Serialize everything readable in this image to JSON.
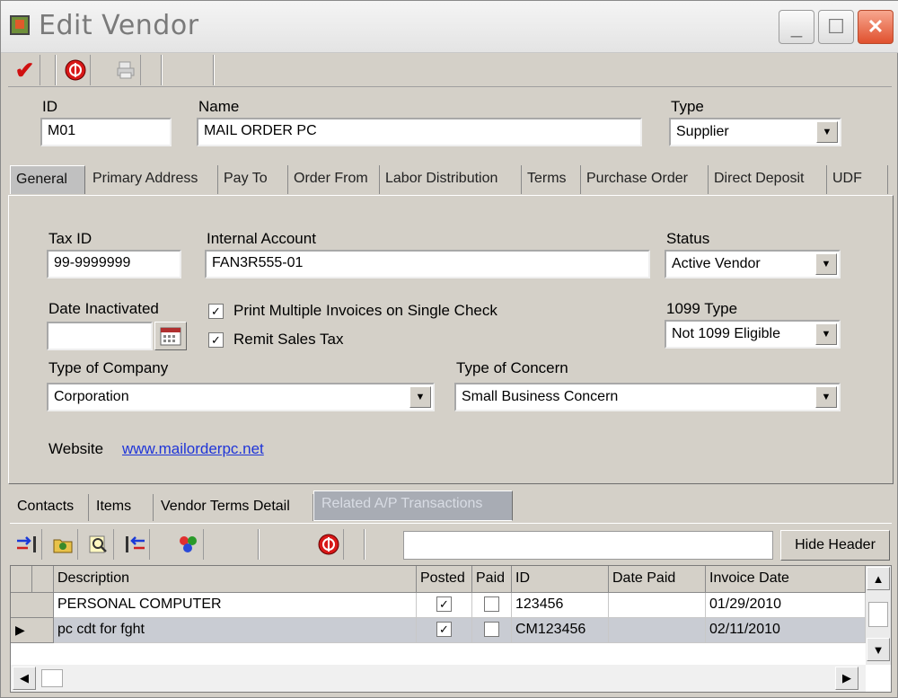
{
  "window": {
    "title": "Edit Vendor"
  },
  "header": {
    "id_label": "ID",
    "id_value": "M01",
    "name_label": "Name",
    "name_value": "MAIL ORDER PC",
    "type_label": "Type",
    "type_value": "Supplier"
  },
  "tabs": [
    "General",
    "Primary Address",
    "Pay To",
    "Order From",
    "Labor Distribution",
    "Terms",
    "Purchase Order",
    "Direct Deposit",
    "UDF"
  ],
  "general": {
    "tax_id_label": "Tax ID",
    "tax_id_value": "99-9999999",
    "internal_account_label": "Internal Account",
    "internal_account_value": "FAN3R555-01",
    "status_label": "Status",
    "status_value": "Active Vendor",
    "date_inactivated_label": "Date Inactivated",
    "date_inactivated_value": "",
    "print_multiple_label": "Print Multiple Invoices on Single Check",
    "print_multiple_checked": true,
    "remit_sales_tax_label": "Remit Sales Tax",
    "remit_sales_tax_checked": true,
    "type_1099_label": "1099 Type",
    "type_1099_value": "Not 1099 Eligible",
    "type_of_company_label": "Type of Company",
    "type_of_company_value": "Corporation",
    "type_of_concern_label": "Type of Concern",
    "type_of_concern_value": "Small Business Concern",
    "website_label": "Website",
    "website_value": "www.mailorderpc.net"
  },
  "bottom_tabs": [
    "Contacts",
    "Items",
    "Vendor Terms Detail",
    "Related A/P Transactions"
  ],
  "grid": {
    "hide_header_label": "Hide Header",
    "columns": [
      "Description",
      "Posted",
      "Paid",
      "ID",
      "Date Paid",
      "Invoice Date"
    ],
    "rows": [
      {
        "description": "PERSONAL COMPUTER",
        "posted": "✓",
        "paid": "",
        "id": "123456",
        "date_paid": "",
        "invoice_date": "01/29/2010"
      },
      {
        "description": "pc cdt for fght",
        "posted": "✓",
        "paid": "",
        "id": "CM123456",
        "date_paid": "",
        "invoice_date": "02/11/2010"
      }
    ]
  },
  "colors": {
    "link": "#1f35d8",
    "close_button": "#e0502e",
    "selected_row": "#c9ccd3"
  }
}
